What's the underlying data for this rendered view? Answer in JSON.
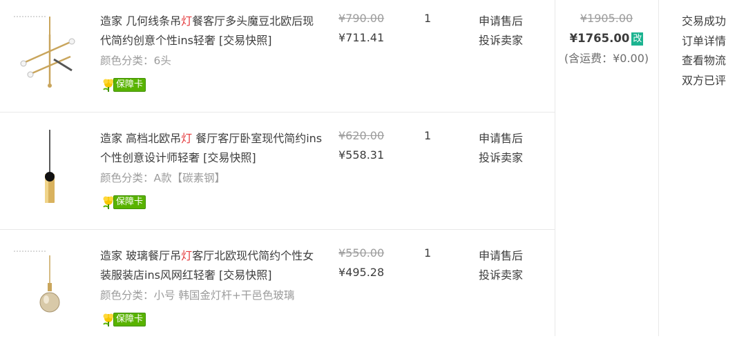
{
  "items": [
    {
      "title_pre": "造家 几何线条吊",
      "title_hl": "灯",
      "title_post": "餐客厅多头魔豆北欧后现代简约创意个性ins轻奢",
      "snapshot": "[交易快照]",
      "sku": "颜色分类：6头",
      "badge": "保障卡",
      "orig_price": "¥790.00",
      "price": "¥711.41",
      "qty": "1",
      "action1": "申请售后",
      "action2": "投诉卖家"
    },
    {
      "title_pre": "造家 高档北欧吊",
      "title_hl": "灯",
      "title_post": " 餐厅客厅卧室现代简约ins个性创意设计师轻奢",
      "snapshot": "[交易快照]",
      "sku": "颜色分类：A款【碳素钢】",
      "badge": "保障卡",
      "orig_price": "¥620.00",
      "price": "¥558.31",
      "qty": "1",
      "action1": "申请售后",
      "action2": "投诉卖家"
    },
    {
      "title_pre": "造家 玻璃餐厅吊",
      "title_hl": "灯",
      "title_post": "客厅北欧现代简约个性女装服装店ins风网红轻奢",
      "snapshot": "[交易快照]",
      "sku": "颜色分类：小号 韩国金灯杆+干邑色玻璃",
      "badge": "保障卡",
      "orig_price": "¥550.00",
      "price": "¥495.28",
      "qty": "1",
      "action1": "申请售后",
      "action2": "投诉卖家"
    }
  ],
  "order": {
    "orig_total": "¥1905.00",
    "total": "¥1765.00",
    "modified_badge": "改",
    "shipping": "(含运费：¥0.00)"
  },
  "status": {
    "state": "交易成功",
    "details": "订单详情",
    "logistics": "查看物流",
    "review": "双方已评"
  }
}
